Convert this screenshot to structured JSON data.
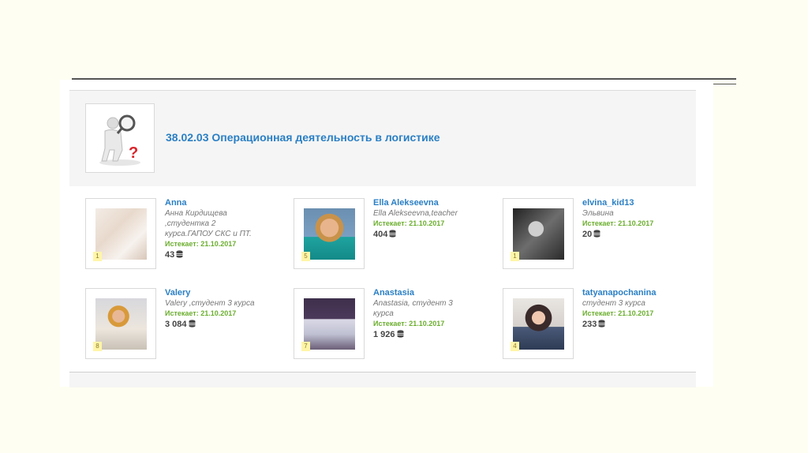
{
  "course": {
    "title": "38.02.03 Операционная деятельность в логистике",
    "icon": "search-person-question-icon"
  },
  "users": [
    {
      "name": "Anna",
      "desc": "Анна Кирдищева ,студентка 2 курса.ГАПОУ СКС и ПТ.",
      "expires": "Истекает: 21.10.2017",
      "points": "43",
      "rank": "1"
    },
    {
      "name": "Ella Alekseevna",
      "desc": "Ella Alekseevna,teacher",
      "expires": "Истекает: 21.10.2017",
      "points": "404",
      "rank": "5"
    },
    {
      "name": "elvina_kid13",
      "desc": "Эльвина",
      "expires": "Истекает: 21.10.2017",
      "points": "20",
      "rank": "1"
    },
    {
      "name": "Valery",
      "desc": "Valery ,студент 3 курса",
      "expires": "Истекает: 21.10.2017",
      "points": "3 084",
      "rank": "8"
    },
    {
      "name": "Anastasia",
      "desc": "Anastasia, студент 3 курса",
      "expires": "Истекает: 21.10.2017",
      "points": "1 926",
      "rank": "7"
    },
    {
      "name": "tatyanapochanina",
      "desc": "студент 3 курса",
      "expires": "Истекает: 21.10.2017",
      "points": "233",
      "rank": "4"
    }
  ],
  "colors": {
    "link": "#2a7fc4",
    "expires": "#6bae2e",
    "background": "#fefef2"
  }
}
